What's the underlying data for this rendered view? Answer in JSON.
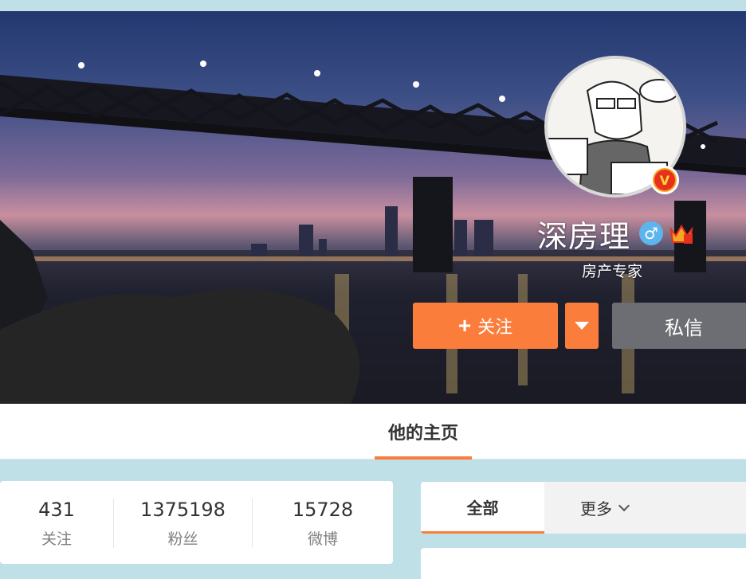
{
  "profile": {
    "name": "深房理",
    "verified_title": "房产专家",
    "gender_symbol": "♂",
    "verified_badge": "V"
  },
  "actions": {
    "follow_plus": "+",
    "follow_label": "关注",
    "message_label": "私信"
  },
  "nav": {
    "home_tab": "他的主页"
  },
  "stats": [
    {
      "value": "431",
      "label": "关注"
    },
    {
      "value": "1375198",
      "label": "粉丝"
    },
    {
      "value": "15728",
      "label": "微博"
    }
  ],
  "feed_tabs": {
    "all": "全部",
    "more": "更多"
  },
  "colors": {
    "accent": "#fa7d3c",
    "message_button": "#6c6e73",
    "background": "#bfe0e6"
  },
  "icons": [
    "plus-icon",
    "caret-down-icon",
    "male-icon",
    "verified-v-icon",
    "vip-crown-icon",
    "chevron-down-icon"
  ]
}
